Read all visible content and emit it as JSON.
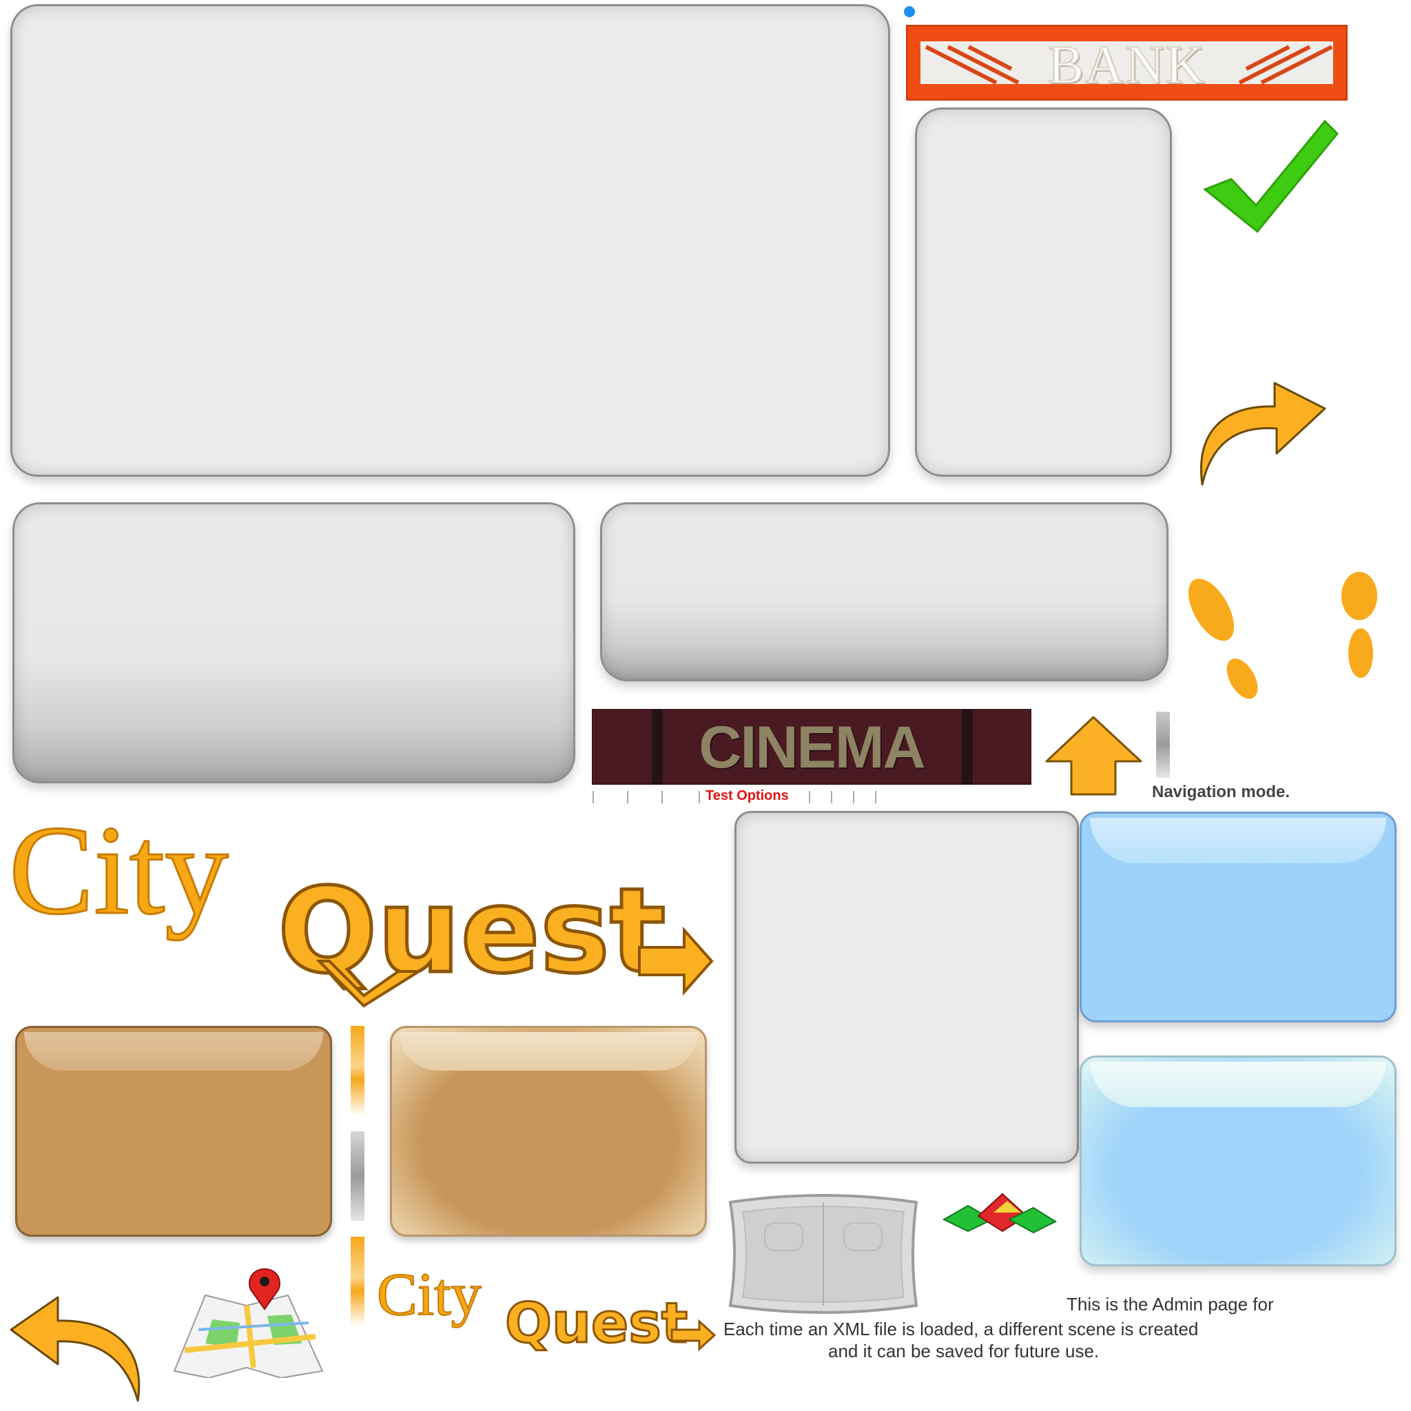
{
  "signs": {
    "bank": "BANK",
    "cinema": "CINEMA"
  },
  "menu": {
    "test_options": "Test Options"
  },
  "status": {
    "navigation_mode": "Navigation mode."
  },
  "logo": {
    "city": "City",
    "quest": "Quest"
  },
  "admin": {
    "line1": "This is the Admin page for",
    "line2": "Each time an XML file is loaded, a different scene is created",
    "line3": "and it can be saved for future use."
  },
  "colors": {
    "accent_orange": "#f7a814",
    "check_green": "#3ecb12",
    "bank_red": "#f04d14",
    "cinema_maroon": "#4a1a22",
    "menu_red": "#e21212",
    "panel_blue": "#9ed2fa",
    "panel_tan": "#c9965a"
  },
  "icons": [
    "checkmark-icon",
    "curved-arrow-right-icon",
    "curved-arrow-left-icon",
    "arrow-up-icon",
    "footprints-icon",
    "map-pin-icon",
    "balance-board-icon",
    "gems-icon",
    "dot-icon"
  ]
}
